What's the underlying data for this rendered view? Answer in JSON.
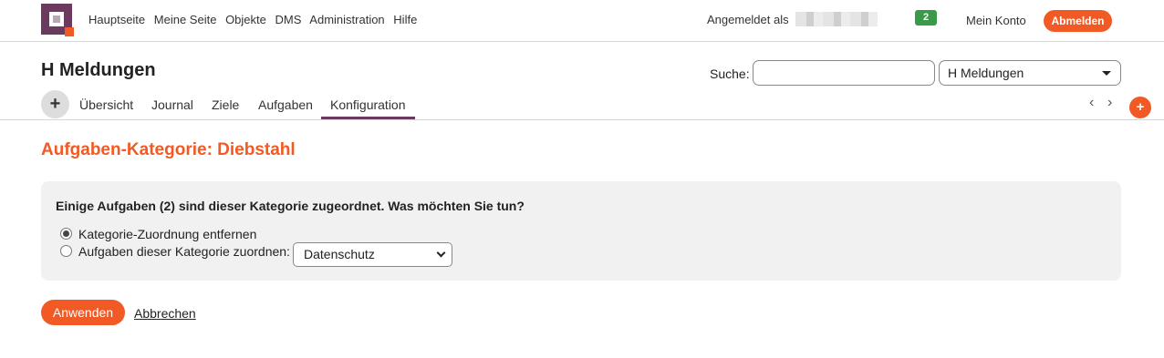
{
  "topnav": {
    "items": [
      "Hauptseite",
      "Meine Seite",
      "Objekte",
      "DMS",
      "Administration",
      "Hilfe"
    ]
  },
  "user": {
    "logged_in_label": "Angemeldet als",
    "notification_count": "2",
    "account_label": "Mein Konto",
    "logout_label": "Abmelden"
  },
  "project": {
    "title": "H Meldungen",
    "search_label": "Suche:",
    "search_value": "",
    "selected_project": "H Meldungen"
  },
  "tabs": {
    "add_label": "+",
    "items": [
      "Übersicht",
      "Journal",
      "Ziele",
      "Aufgaben",
      "Konfiguration"
    ],
    "active": "Konfiguration",
    "prev_label": "‹",
    "next_label": "›",
    "fab_label": "+"
  },
  "content": {
    "title": "Aufgaben-Kategorie: Diebstahl",
    "question": "Einige Aufgaben (2) sind dieser Kategorie zugeordnet. Was möchten Sie tun?",
    "option_remove": "Kategorie-Zuordnung entfernen",
    "option_reassign": "Aufgaben dieser Kategorie zuordnen:",
    "selected_option": "remove",
    "reassign_category": "Datenschutz",
    "apply_label": "Anwenden",
    "cancel_label": "Abbrechen"
  },
  "colors": {
    "brand": "#6b3a5e",
    "accent": "#f15a24",
    "badge": "#3a9a4a"
  }
}
